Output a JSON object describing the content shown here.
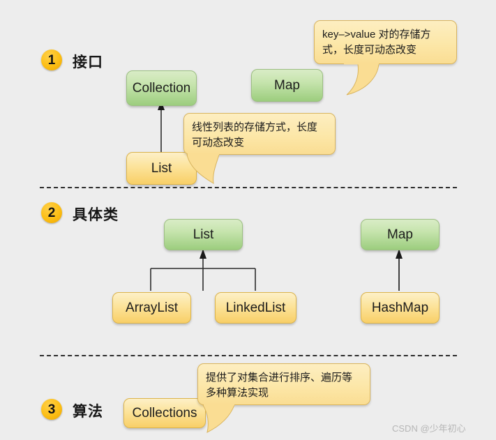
{
  "sections": [
    {
      "number": "1",
      "title": "接口"
    },
    {
      "number": "2",
      "title": "具体类"
    },
    {
      "number": "3",
      "title": "算法"
    }
  ],
  "nodes": {
    "collection": "Collection",
    "map_interface": "Map",
    "list_interface": "List",
    "list_class": "List",
    "map_class": "Map",
    "arraylist": "ArrayList",
    "linkedlist": "LinkedList",
    "hashmap": "HashMap",
    "collections": "Collections"
  },
  "callouts": {
    "map_note": "key–>value 对的存储方式，长度可动态改变",
    "list_note": "线性列表的存储方式，长度可动态改变",
    "collections_note": "提供了对集合进行排序、遍历等多种算法实现"
  },
  "watermark": "CSDN @少年初心",
  "colors": {
    "background": "#ededed",
    "green_box": "#9ccd7e",
    "yellow_box": "#f8cf67",
    "callout_bg": "#fadd93",
    "badge": "#fcbe14",
    "arrow": "#2c2c2c"
  }
}
